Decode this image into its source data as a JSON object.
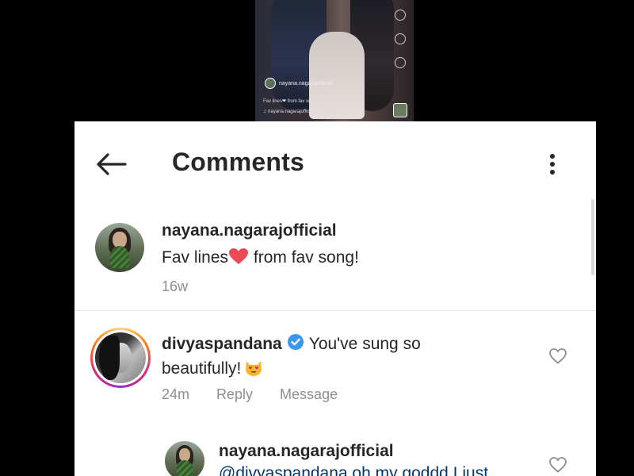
{
  "video": {
    "username": "nayana.nagarajofficial",
    "caption_line1": "Fav lines❤ from fav song",
    "caption_line2": "♫ nayana.nagarajofficial · Original Audio"
  },
  "header": {
    "title": "Comments"
  },
  "caption": {
    "username": "nayana.nagarajofficial",
    "text_before": "Fav lines",
    "text_after": " from fav song!",
    "time": "16w"
  },
  "comments": [
    {
      "username": "divyaspandana",
      "verified": true,
      "text_line1": "You've sung so",
      "text_line2": "beautifully!",
      "time": "24m",
      "reply_label": "Reply",
      "message_label": "Message"
    }
  ],
  "reply": {
    "username": "nayana.nagarajofficial",
    "text": "@divyaspandana oh my goddd I just"
  },
  "colors": {
    "heart": "#ed4956",
    "verified": "#3897f0",
    "meta": "#8e8e8e"
  },
  "icons": {
    "back": "arrow-left-icon",
    "more": "more-vertical-icon",
    "like": "heart-outline-icon",
    "verified": "verified-badge-icon",
    "emoji": "heart-eyes-cat-emoji"
  }
}
